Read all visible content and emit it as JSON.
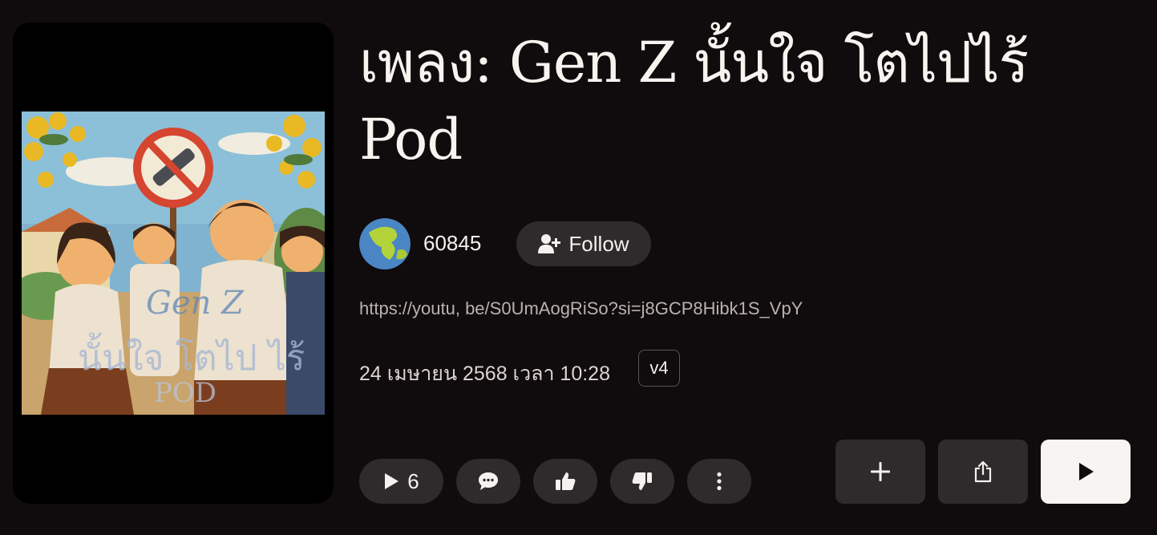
{
  "song": {
    "title": "เพลง: Gen Z นั้นใจ โตไปไร้ Pod",
    "creator": "60845",
    "link": "https://youtu, be/S0UmAogRiSo?si=j8GCP8Hibk1S_VpY",
    "date": "24 เมษายน 2568 เวลา 10:28",
    "version": "v4"
  },
  "cover": {
    "overlay_line1": "Gen Z",
    "overlay_line2": "นั้นใจ โตไป ไร้",
    "overlay_line3": "POD"
  },
  "actions": {
    "follow_label": "Follow",
    "play_count": "6"
  },
  "icons": {
    "follow": "person-plus-icon",
    "play": "play-icon",
    "comment": "comment-icon",
    "like": "thumbs-up-icon",
    "dislike": "thumbs-down-icon",
    "more": "more-vertical-icon",
    "add": "plus-icon",
    "share": "share-icon"
  },
  "colors": {
    "background": "#100b0c",
    "button": "#2f2a2b",
    "play_button": "#f7f4f1"
  }
}
